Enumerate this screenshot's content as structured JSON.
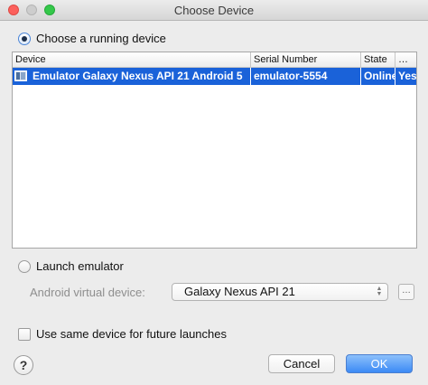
{
  "window": {
    "title": "Choose Device"
  },
  "running": {
    "label": "Choose a running device",
    "selected": true,
    "table": {
      "columns": [
        "Device",
        "Serial Number",
        "State",
        "…"
      ],
      "rows": [
        {
          "device": "Emulator Galaxy Nexus API 21 Android 5",
          "serial": "emulator-5554",
          "state": "Online",
          "extra": "Yes"
        }
      ]
    }
  },
  "launch": {
    "label": "Launch emulator",
    "selected": false,
    "avd_label": "Android virtual device:",
    "avd_value": "Galaxy Nexus API 21",
    "more_label": "…"
  },
  "future": {
    "label": "Use same device for future launches",
    "checked": false
  },
  "buttons": {
    "help": "?",
    "cancel": "Cancel",
    "ok": "OK"
  },
  "colors": {
    "selection": "#1a62d9",
    "ok_button": "#3c8af5"
  }
}
